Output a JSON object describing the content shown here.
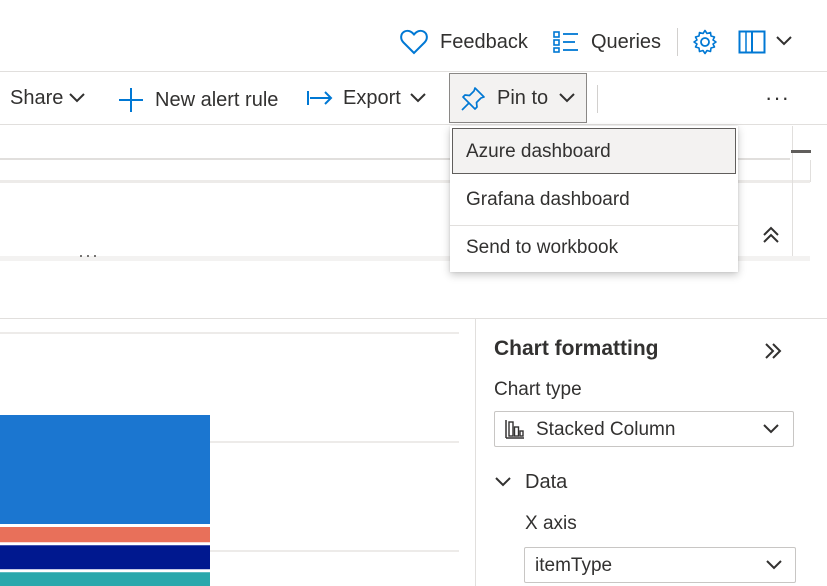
{
  "top_bar": {
    "feedback_label": "Feedback",
    "queries_label": "Queries",
    "icons": [
      "heart-icon",
      "list-icon",
      "gear-icon",
      "book-icon",
      "chevron-down-icon"
    ]
  },
  "toolbar": {
    "share_label": "Share",
    "new_alert_label": "New alert rule",
    "export_label": "Export",
    "pin_to_label": "Pin to",
    "more_label": "···"
  },
  "pin_menu": {
    "items": [
      {
        "label": "Azure dashboard"
      },
      {
        "label": "Grafana dashboard"
      },
      {
        "label": "Send to workbook"
      }
    ]
  },
  "results": {
    "more_label": "···"
  },
  "chart_formatting": {
    "title": "Chart formatting",
    "chart_type_label": "Chart type",
    "chart_type_value": "Stacked Column",
    "data_section_label": "Data",
    "x_axis_label": "X axis",
    "x_axis_value": "itemType"
  },
  "colors": {
    "accent": "#0078d4",
    "series": [
      "#1b76d0",
      "#e8705a",
      "#00188f",
      "#2aa8ac"
    ],
    "selected_bg": "#f3f2f1"
  },
  "chart_data": {
    "type": "bar",
    "categories": [
      ""
    ],
    "series": [
      {
        "values": [
          0.5
        ]
      },
      {
        "values": [
          0.07
        ]
      },
      {
        "values": [
          0.11
        ]
      },
      {
        "values": [
          0.12
        ]
      }
    ]
  }
}
